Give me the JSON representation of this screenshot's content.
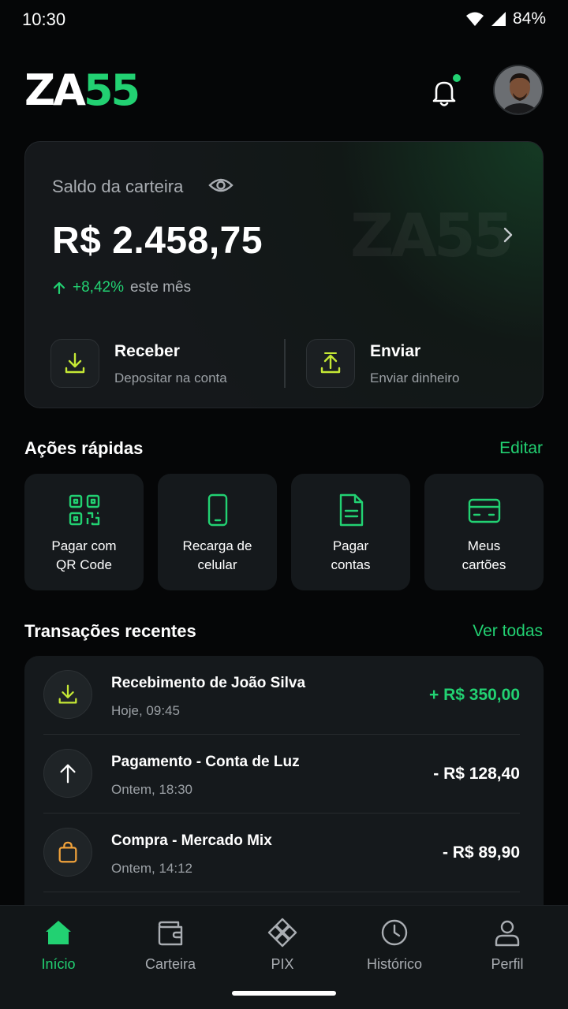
{
  "status_bar": {
    "time": "10:30",
    "battery": "84%"
  },
  "header": {
    "logo_part1": "ZA",
    "logo_part2": "55"
  },
  "balance": {
    "label": "Saldo da carteira",
    "amount": "R$ 2.458,75",
    "growth_pct": "+8,42%",
    "growth_text": "este mês",
    "watermark": "ZA55",
    "receive_title": "Receber",
    "receive_sub": "Depositar na conta",
    "send_title": "Enviar",
    "send_sub": "Enviar dinheiro"
  },
  "quick_actions": {
    "title": "Ações rápidas",
    "edit_label": "Editar",
    "items": [
      {
        "label": "Pagar com\nQR Code",
        "icon": "qr-code-icon"
      },
      {
        "label": "Recarga de\ncelular",
        "icon": "phone-icon"
      },
      {
        "label": "Pagar\ncontas",
        "icon": "document-icon"
      },
      {
        "label": "Meus\ncartões",
        "icon": "credit-card-icon"
      }
    ]
  },
  "transactions": {
    "title": "Transações recentes",
    "see_all_label": "Ver todas",
    "items": [
      {
        "title": "Recebimento de João Silva",
        "date": "Hoje, 09:45",
        "amount": "+ R$ 350,00"
      },
      {
        "title": "Pagamento - Conta de Luz",
        "date": "Ontem, 18:30",
        "amount": "- R$ 128,40"
      },
      {
        "title": "Compra - Mercado Mix",
        "date": "Ontem, 14:12",
        "amount": "- R$ 89,90"
      }
    ]
  },
  "bottom_nav": {
    "items": [
      {
        "label": "Início"
      },
      {
        "label": "Carteira"
      },
      {
        "label": "PIX"
      },
      {
        "label": "Histórico"
      },
      {
        "label": "Perfil"
      }
    ]
  },
  "colors": {
    "accent": "#22d172",
    "background": "#050607",
    "card": "#15191c"
  }
}
